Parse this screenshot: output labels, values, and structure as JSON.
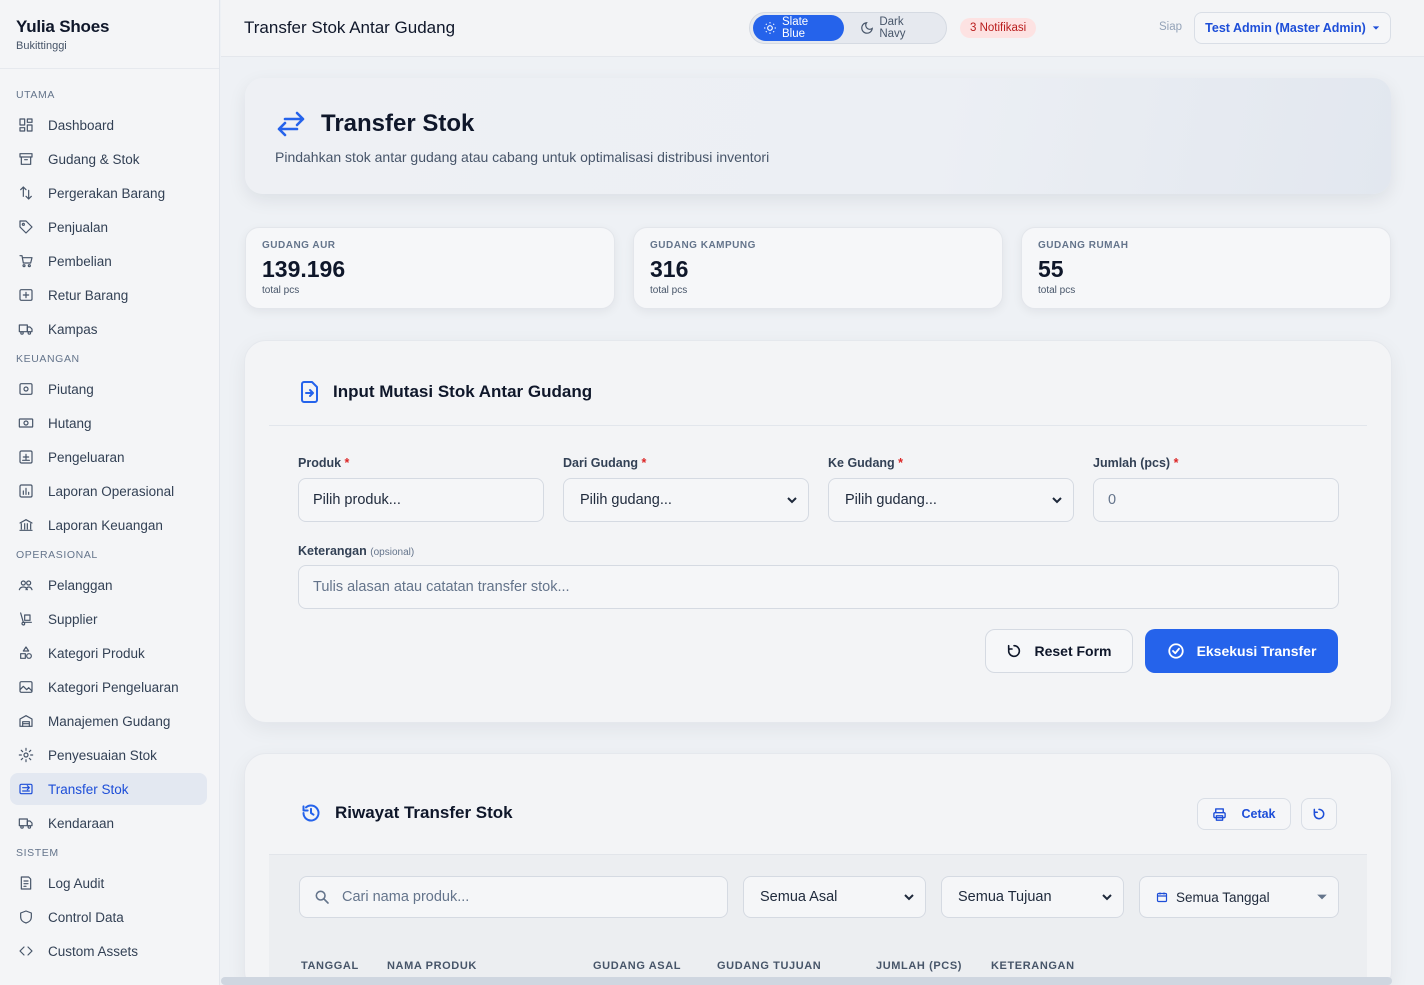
{
  "brand": {
    "name": "Yulia Shoes",
    "location": "Bukittinggi"
  },
  "sidebar": {
    "sections": [
      {
        "title": "UTAMA",
        "items": [
          {
            "label": "Dashboard",
            "icon": "dashboard-icon"
          },
          {
            "label": "Gudang & Stok",
            "icon": "archive-icon"
          },
          {
            "label": "Pergerakan Barang",
            "icon": "arrows-icon"
          },
          {
            "label": "Penjualan",
            "icon": "tag-icon"
          },
          {
            "label": "Pembelian",
            "icon": "cart-icon"
          },
          {
            "label": "Retur Barang",
            "icon": "return-box-icon"
          },
          {
            "label": "Kampas",
            "icon": "truck-icon"
          }
        ]
      },
      {
        "title": "KEUANGAN",
        "items": [
          {
            "label": "Piutang",
            "icon": "receivable-icon"
          },
          {
            "label": "Hutang",
            "icon": "cash-icon"
          },
          {
            "label": "Pengeluaran",
            "icon": "expense-icon"
          },
          {
            "label": "Laporan Operasional",
            "icon": "report-icon"
          },
          {
            "label": "Laporan Keuangan",
            "icon": "bank-icon"
          }
        ]
      },
      {
        "title": "OPERASIONAL",
        "items": [
          {
            "label": "Pelanggan",
            "icon": "users-icon"
          },
          {
            "label": "Supplier",
            "icon": "dolly-icon"
          },
          {
            "label": "Kategori Produk",
            "icon": "shapes-icon"
          },
          {
            "label": "Kategori Pengeluaran",
            "icon": "image-box-icon"
          },
          {
            "label": "Manajemen Gudang",
            "icon": "warehouse-icon"
          },
          {
            "label": "Penyesuaian Stok",
            "icon": "gear-icon"
          },
          {
            "label": "Transfer Stok",
            "icon": "transfer-icon",
            "active": true
          },
          {
            "label": "Kendaraan",
            "icon": "truck-icon"
          }
        ]
      },
      {
        "title": "SISTEM",
        "items": [
          {
            "label": "Log Audit",
            "icon": "audit-icon"
          },
          {
            "label": "Control Data",
            "icon": "shield-icon"
          },
          {
            "label": "Custom Assets",
            "icon": "code-icon"
          }
        ]
      }
    ]
  },
  "topbar": {
    "title": "Transfer Stok Antar Gudang",
    "theme_light": "Slate Blue",
    "theme_dark": "Dark Navy",
    "notifications": "3 Notifikasi",
    "status": "Siap",
    "user": "Test Admin (Master Admin)"
  },
  "hero": {
    "title": "Transfer Stok",
    "subtitle": "Pindahkan stok antar gudang atau cabang untuk optimalisasi distribusi inventori"
  },
  "stats": [
    {
      "label": "GUDANG AUR",
      "value": "139.196",
      "unit": "total pcs"
    },
    {
      "label": "GUDANG KAMPUNG",
      "value": "316",
      "unit": "total pcs"
    },
    {
      "label": "GUDANG RUMAH",
      "value": "55",
      "unit": "total pcs"
    }
  ],
  "form": {
    "title": "Input Mutasi Stok Antar Gudang",
    "product_label": "Produk",
    "product_value": "Pilih produk...",
    "from_label": "Dari Gudang",
    "from_value": "Pilih gudang...",
    "to_label": "Ke Gudang",
    "to_value": "Pilih gudang...",
    "qty_label": "Jumlah (pcs)",
    "qty_placeholder": "0",
    "note_label": "Keterangan",
    "note_optional": "(opsional)",
    "note_placeholder": "Tulis alasan atau catatan transfer stok...",
    "required_mark": "*",
    "reset_label": "Reset Form",
    "submit_label": "Eksekusi Transfer"
  },
  "history": {
    "title": "Riwayat Transfer Stok",
    "print_label": "Cetak",
    "search_placeholder": "Cari nama produk...",
    "origin_filter": "Semua Asal",
    "dest_filter": "Semua Tujuan",
    "date_filter": "Semua Tanggal",
    "columns": [
      "TANGGAL",
      "NAMA PRODUK",
      "GUDANG ASAL",
      "GUDANG TUJUAN",
      "JUMLAH (PCS)",
      "KETERANGAN"
    ]
  },
  "colors": {
    "accent": "#2563eb",
    "danger": "#dc2626",
    "badge_bg": "#fde2e2"
  }
}
